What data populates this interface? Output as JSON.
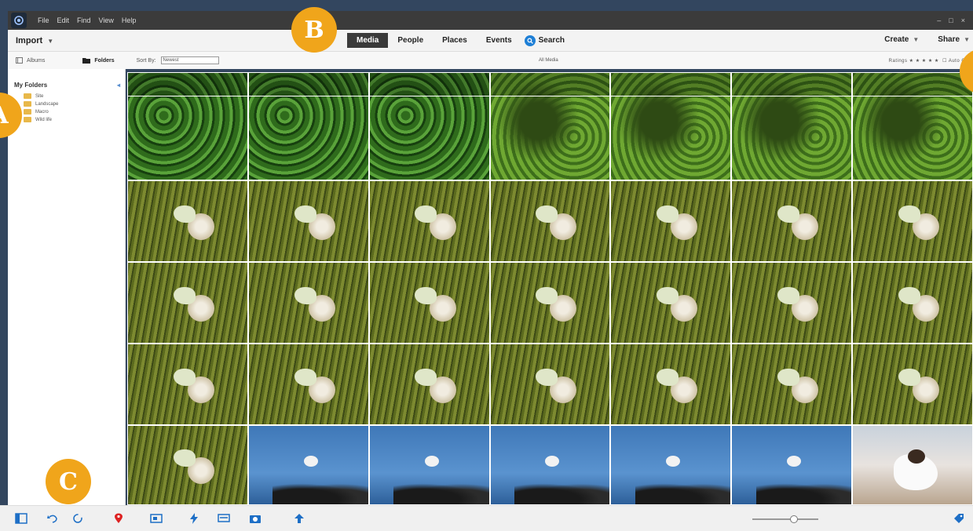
{
  "window": {
    "menu": [
      "File",
      "Edit",
      "Find",
      "View",
      "Help"
    ],
    "controls": [
      "–",
      "□",
      "×"
    ]
  },
  "toolbar": {
    "import_label": "Import",
    "tabs": [
      "Media",
      "People",
      "Places",
      "Events"
    ],
    "search_label": "Search",
    "create_label": "Create",
    "share_label": "Share"
  },
  "subbar": {
    "albums_label": "Albums",
    "folders_label": "Folders",
    "sort_label": "Sort By:",
    "sort_value": "Newest",
    "view_label": "All Media",
    "ratings_label": "Ratings ★ ★ ★ ★ ★",
    "autocurator_label": "Auto Cu"
  },
  "sidebar": {
    "title": "My Folders",
    "folders": [
      "Site",
      "Landscape",
      "Macro",
      "Wild life"
    ]
  },
  "markers": [
    "A",
    "B",
    "C"
  ],
  "colors": {
    "orange_marker": "#f0a51b",
    "active_tab": "#3a3a3a",
    "search_blue": "#1e7fd6",
    "folder_yellow": "#e8b84a"
  },
  "grid": {
    "columns": 7,
    "rows": [
      "leaves-a, leaves-a, leaves-a, leaves-b, leaves-b, leaves-b, leaves-b",
      "butterfly x7",
      "butterfly x7",
      "butterfly x7",
      "butterfly, gull x5, blackheaded-gull"
    ]
  }
}
